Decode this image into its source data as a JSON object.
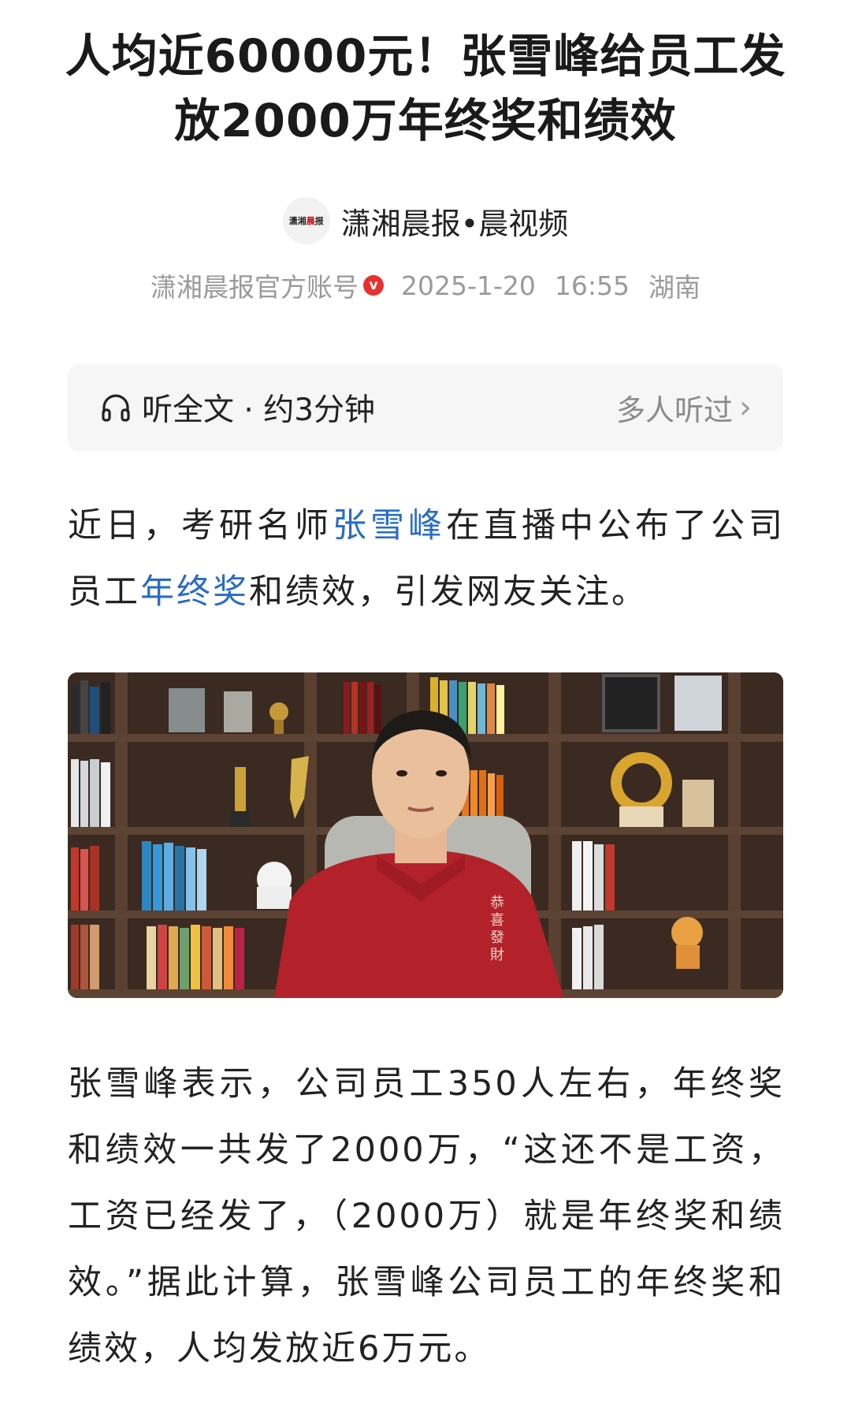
{
  "article": {
    "title_line1": "人均近60000元！张雪峰给员工发",
    "title_line2": "放2000万年终奖和绩效",
    "source": {
      "logo_text_a": "潇湘",
      "logo_text_b": "晨",
      "logo_text_c": "报",
      "name": "潇湘晨报•晨视频"
    },
    "meta": {
      "account": "潇湘晨报官方账号",
      "verified_mark": "v",
      "date": "2025-1-20",
      "time": "16:55",
      "location": "湖南"
    },
    "listen": {
      "label": "听全文 · 约3分钟",
      "listeners": "多人听过",
      "chevron": "›"
    },
    "paragraph1": {
      "t1": "近日，考研名师",
      "link1": "张雪峰",
      "t2": "在直播中公布了公司员工",
      "link2": "年终奖",
      "t3": "和绩效，引发网友关注。"
    },
    "paragraph2": "张雪峰表示，公司员工350人左右，年终奖和绩效一共发了2000万，“这还不是工资，工资已经发了，（2000万）就是年终奖和绩效。”据此计算，张雪峰公司员工的年终奖和绩效，人均发放近6万元。",
    "image": {
      "jacket_text_1": "恭",
      "jacket_text_2": "喜",
      "jacket_text_3": "發",
      "jacket_text_4": "財"
    }
  },
  "colors": {
    "link": "#2a6cc6",
    "badge": "#e8312f",
    "jacket": "#b3212a",
    "shelf": "#3c2b22"
  },
  "icons": {
    "listen": "headphones-icon",
    "more": "chevron-right-icon",
    "verified": "verified-badge-icon"
  }
}
